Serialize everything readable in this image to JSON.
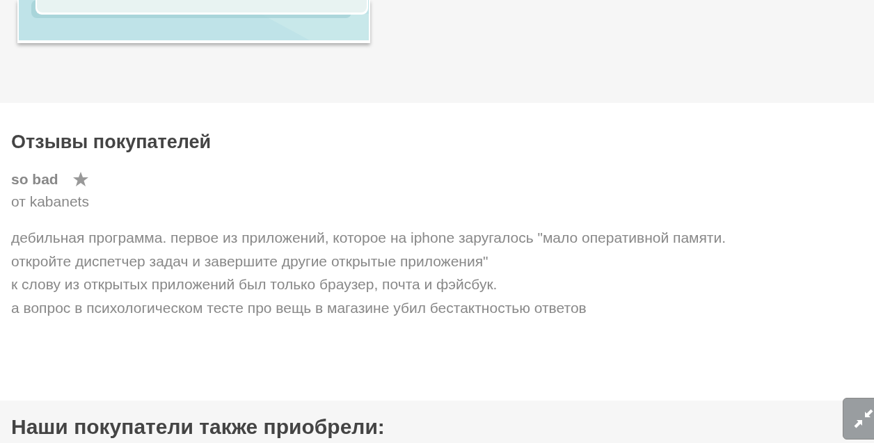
{
  "reviews_section": {
    "title": "Отзывы покупателей",
    "reviews": [
      {
        "title": "so bad",
        "author": "от kabanets",
        "text": "дебильная программа. первое из приложений, которое на iphone заругалось \"мало оперативной памяти. откройте диспетчер задач и завершите другие открытые приложения\"\nк слову из открытых приложений был только браузер, почта и фэйсбук.\nа вопрос в психологическом тесте про вещь в магазине убил бестактностью ответов"
      }
    ]
  },
  "also_bought": {
    "title": "Наши покупатели также приобрели:"
  }
}
